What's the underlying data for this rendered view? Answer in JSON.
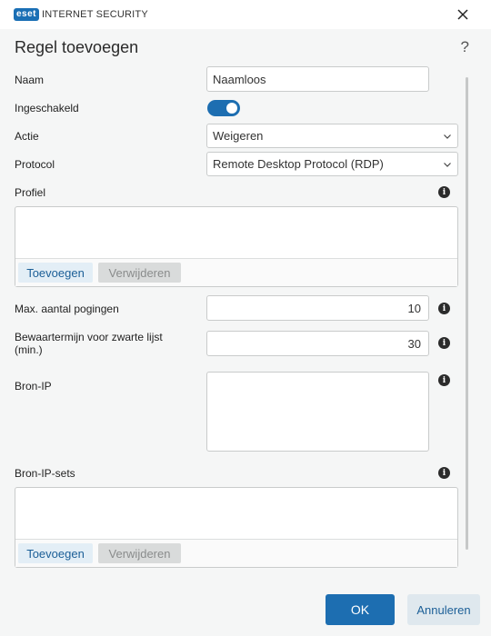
{
  "app": {
    "logo_badge": "eset",
    "logo_text": "INTERNET SECURITY"
  },
  "dialog": {
    "title": "Regel toevoegen",
    "help": "?"
  },
  "form": {
    "name": {
      "label": "Naam",
      "value": "Naamloos"
    },
    "enabled": {
      "label": "Ingeschakeld",
      "on": true
    },
    "action": {
      "label": "Actie",
      "value": "Weigeren"
    },
    "protocol": {
      "label": "Protocol",
      "value": "Remote Desktop Protocol (RDP)"
    },
    "profile": {
      "label": "Profiel",
      "add": "Toevoegen",
      "remove": "Verwijderen"
    },
    "max_attempts": {
      "label": "Max. aantal pogingen",
      "value": "10"
    },
    "retention": {
      "label": "Bewaartermijn voor zwarte lijst (min.)",
      "value": "30"
    },
    "source_ip": {
      "label": "Bron-IP",
      "value": ""
    },
    "source_ip_sets": {
      "label": "Bron-IP-sets",
      "add": "Toevoegen",
      "remove": "Verwijderen"
    }
  },
  "footer": {
    "ok": "OK",
    "cancel": "Annuleren"
  },
  "colors": {
    "accent": "#1d6eb1",
    "background": "#f5f6f6"
  }
}
